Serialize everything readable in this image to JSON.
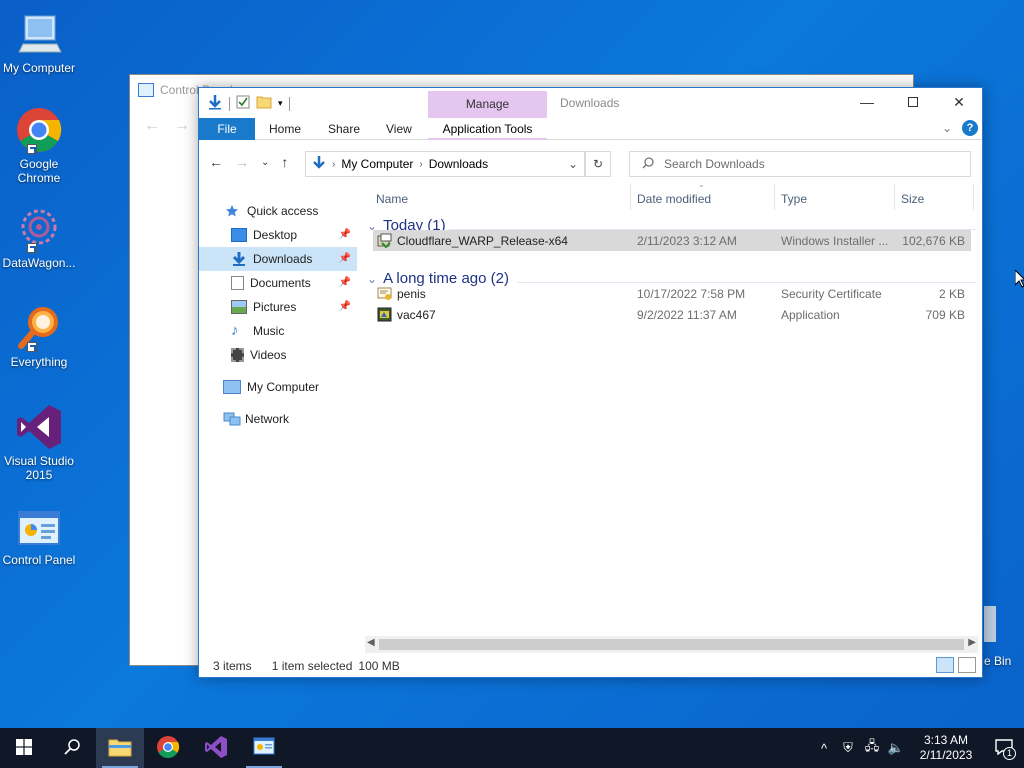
{
  "desktop": {
    "icons": [
      {
        "label": "My Computer"
      },
      {
        "label": "Google Chrome"
      },
      {
        "label": "DataWagon..."
      },
      {
        "label": "Everything"
      },
      {
        "label": "Visual Studio 2015"
      },
      {
        "label": "Control Panel"
      }
    ],
    "recycle_bin_label": "e Bin"
  },
  "back_window": {
    "title": "Control Panel"
  },
  "explorer": {
    "title": "Downloads",
    "manage_tab": "Manage",
    "ribbon_tabs": {
      "file": "File",
      "home": "Home",
      "share": "Share",
      "view": "View",
      "app_tools": "Application Tools"
    },
    "address": {
      "root": "My Computer",
      "current": "Downloads"
    },
    "search_placeholder": "Search Downloads",
    "sidebar": {
      "quick_access": "Quick access",
      "items": [
        {
          "label": "Desktop",
          "pinned": true
        },
        {
          "label": "Downloads",
          "pinned": true,
          "selected": true
        },
        {
          "label": "Documents",
          "pinned": true
        },
        {
          "label": "Pictures",
          "pinned": true
        },
        {
          "label": "Music"
        },
        {
          "label": "Videos"
        }
      ],
      "my_computer": "My Computer",
      "network": "Network"
    },
    "columns": {
      "name": "Name",
      "date": "Date modified",
      "type": "Type",
      "size": "Size"
    },
    "groups": [
      {
        "label": "Today (1)",
        "files": [
          {
            "name": "Cloudflare_WARP_Release-x64",
            "date": "2/11/2023 3:12 AM",
            "type": "Windows Installer ...",
            "size": "102,676 KB",
            "selected": true
          }
        ]
      },
      {
        "label": "A long time ago (2)",
        "files": [
          {
            "name": "penis",
            "date": "10/17/2022 7:58 PM",
            "type": "Security Certificate",
            "size": "2 KB"
          },
          {
            "name": "vac467",
            "date": "9/2/2022 11:37 AM",
            "type": "Application",
            "size": "709 KB"
          }
        ]
      }
    ],
    "status": {
      "count": "3 items",
      "selected": "1 item selected",
      "size": "100 MB"
    }
  },
  "taskbar": {
    "time": "3:13 AM",
    "date": "2/11/2023",
    "notification_count": "1"
  }
}
